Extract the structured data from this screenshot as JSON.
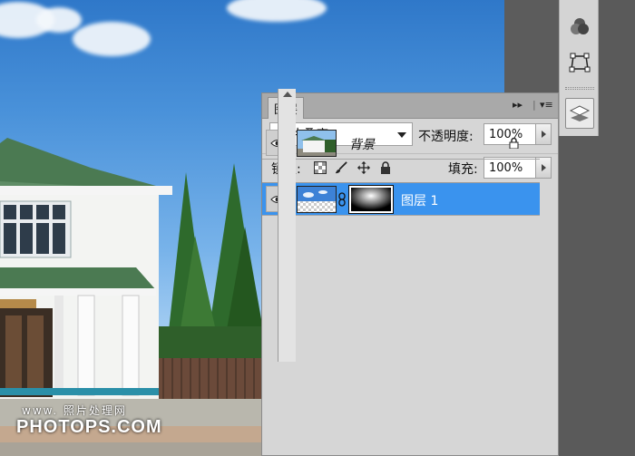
{
  "panel": {
    "tab_label": "图层",
    "blend_mode": "正片叠底",
    "opacity_label": "不透明度:",
    "opacity_value": "100%",
    "lock_label": "锁定:",
    "fill_label": "填充:",
    "fill_value": "100%",
    "layers": [
      {
        "name": "图层 1",
        "selected": true,
        "visible": true,
        "has_mask": true
      },
      {
        "name": "背景",
        "selected": false,
        "visible": true,
        "locked": true
      }
    ]
  },
  "watermark": {
    "line1": "www. 照片处理网",
    "line2": "PHOTOPS.COM"
  },
  "colors": {
    "selection": "#3a93ee",
    "panel_bg": "#d6d6d6",
    "sky_top": "#2f78c9"
  },
  "icons": [
    "color-wheel-icon",
    "path-icon",
    "layers-icon",
    "eye-icon",
    "lock-icon",
    "chain-link-icon",
    "brush-icon",
    "move-icon",
    "transparency-lock-icon",
    "panel-menu-icon",
    "collapse-icon"
  ]
}
